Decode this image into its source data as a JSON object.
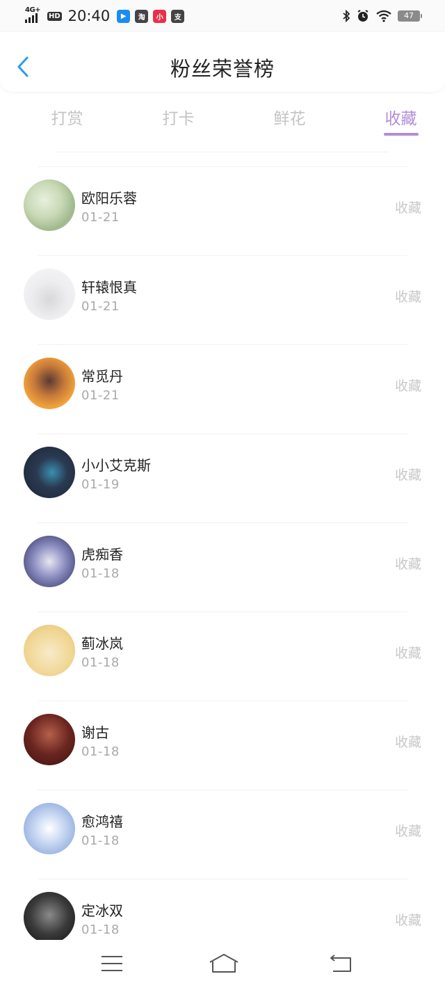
{
  "status_bar": {
    "network": "4G+",
    "hd": "HD",
    "time": "20:40",
    "apps": [
      {
        "icon": "video-app-icon",
        "glyph": "▶",
        "color": "#1c8cf0"
      },
      {
        "icon": "taobao-icon",
        "glyph": "淘",
        "color": "#444444"
      },
      {
        "icon": "mini-program-icon",
        "glyph": "小",
        "color": "#e8304a"
      },
      {
        "icon": "alipay-icon",
        "glyph": "支",
        "color": "#444444"
      }
    ],
    "battery": "47"
  },
  "header": {
    "title": "粉丝荣誉榜"
  },
  "tabs": [
    {
      "label": "打赏",
      "active": false
    },
    {
      "label": "打卡",
      "active": false
    },
    {
      "label": "鲜花",
      "active": false
    },
    {
      "label": "收藏",
      "active": true
    }
  ],
  "colors": {
    "accent": "#b48cd8",
    "back_arrow": "#2a9cf0"
  },
  "fans": [
    {
      "name": "欧阳乐蓉",
      "date": "01-21",
      "action": "收藏",
      "avatar": "floral-pattern-avatar",
      "bg": "radial-gradient(circle at 40% 40%, #e8f0dd 0%, #c9d9b6 40%, #9fb88c 70%, #e6ecd9 100%)"
    },
    {
      "name": "轩辕恨真",
      "date": "01-21",
      "action": "收藏",
      "avatar": "cartoon-elephant-avatar",
      "bg": "radial-gradient(circle at 50% 60%, #d8d8dc 0%, #ededf0 45%, #f7f7f7 100%)"
    },
    {
      "name": "常觅丹",
      "date": "01-21",
      "action": "收藏",
      "avatar": "anime-girl-avatar",
      "bg": "radial-gradient(circle at 50% 45%, #5a3a34 0%, #c77a3a 40%, #f2a33a 70%, #e06a2a 100%)"
    },
    {
      "name": "小小艾克斯",
      "date": "01-19",
      "action": "收藏",
      "avatar": "dark-creature-avatar",
      "bg": "radial-gradient(circle at 55% 50%, #3b8fb0 0%, #2a3a52 40%, #1c2233 100%)"
    },
    {
      "name": "虎痴香",
      "date": "01-18",
      "action": "收藏",
      "avatar": "anime-character-avatar",
      "bg": "radial-gradient(circle at 50% 50%, #e8e6f2 0%, #8a8cc0 45%, #2c2d55 100%)"
    },
    {
      "name": "蓟冰岚",
      "date": "01-18",
      "action": "收藏",
      "avatar": "illustrated-woman-avatar",
      "bg": "radial-gradient(circle at 50% 55%, #f7ebc9 0%, #f2d99a 50%, #e8c272 100%)"
    },
    {
      "name": "谢古",
      "date": "01-18",
      "action": "收藏",
      "avatar": "photo-portrait-avatar",
      "bg": "radial-gradient(circle at 50% 40%, #b5604a 0%, #6a2520 50%, #3a1412 100%)"
    },
    {
      "name": "愈鸿禧",
      "date": "01-18",
      "action": "收藏",
      "avatar": "sky-photo-avatar",
      "bg": "radial-gradient(circle at 50% 50%, #ffffff 0%, #c8d8f2 40%, #7a9ad6 100%)"
    },
    {
      "name": "定冰双",
      "date": "01-18",
      "action": "收藏",
      "avatar": "dark-photo-avatar",
      "bg": "radial-gradient(circle at 50% 45%, #8a8a8a 0%, #3a3a3a 50%, #111111 100%)"
    }
  ],
  "bottom_nav": {
    "menu": "menu-icon",
    "home": "home-icon",
    "back": "back-icon"
  }
}
